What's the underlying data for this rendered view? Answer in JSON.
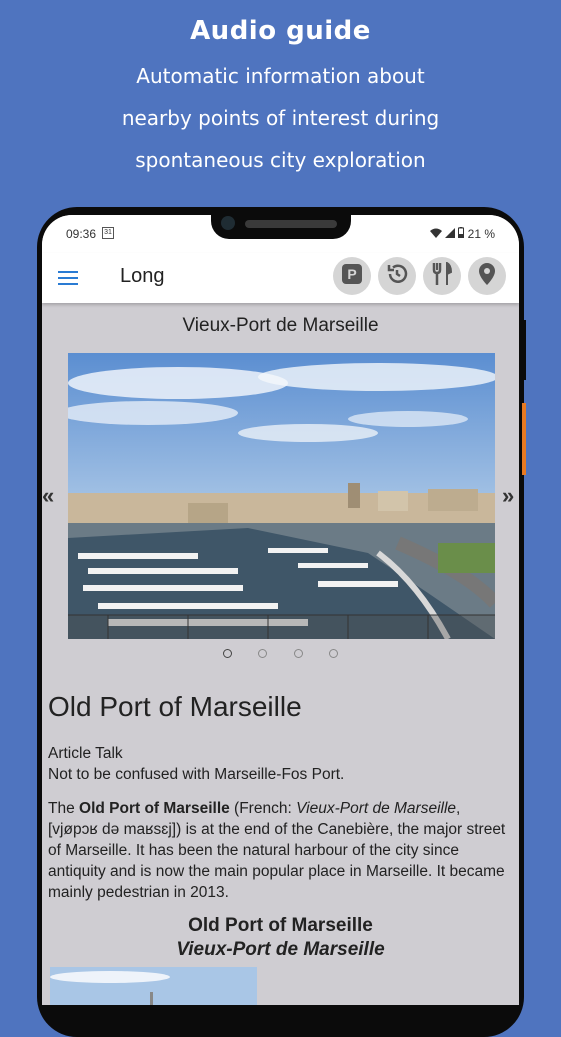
{
  "promo": {
    "title": "Audio guide",
    "lines": [
      "Automatic information about",
      "nearby points of interest during",
      "spontaneous city exploration"
    ]
  },
  "status_bar": {
    "time": "09:36",
    "calendar_day": "31",
    "battery": "21 %"
  },
  "app_bar": {
    "title": "Long",
    "actions": [
      "parking-icon",
      "history-icon",
      "restaurant-icon",
      "location-pin-icon"
    ]
  },
  "place": {
    "title": "Vieux-Port de Marseille",
    "carousel_prev": "«",
    "carousel_next": "»",
    "carousel_pages": 4,
    "carousel_active": 0
  },
  "article": {
    "heading": "Old Port of Marseille",
    "tabs": "Article Talk",
    "hatnote": "Not to be confused with Marseille-Fos Port.",
    "intro_bold": "Old Port of Marseille",
    "intro_prefix": "The ",
    "intro_after_bold": " (French: ",
    "intro_italic": "Vieux-Port de Marseille",
    "intro_rest": ", [vjøpɔʁ də maʁsɛj]) is at the end of the Canebière, the major street of Marseille. It has been the natural harbour of the city since antiquity and is now the main popular place in Marseille. It became mainly pedestrian in 2013.",
    "infobox_title": "Old Port of Marseille",
    "infobox_subtitle": "Vieux-Port de Marseille"
  },
  "colors": {
    "background": "#4f74bf",
    "accent": "#2a7bd3",
    "side_button": "#e87a22",
    "screen": "#cfcdd2"
  }
}
